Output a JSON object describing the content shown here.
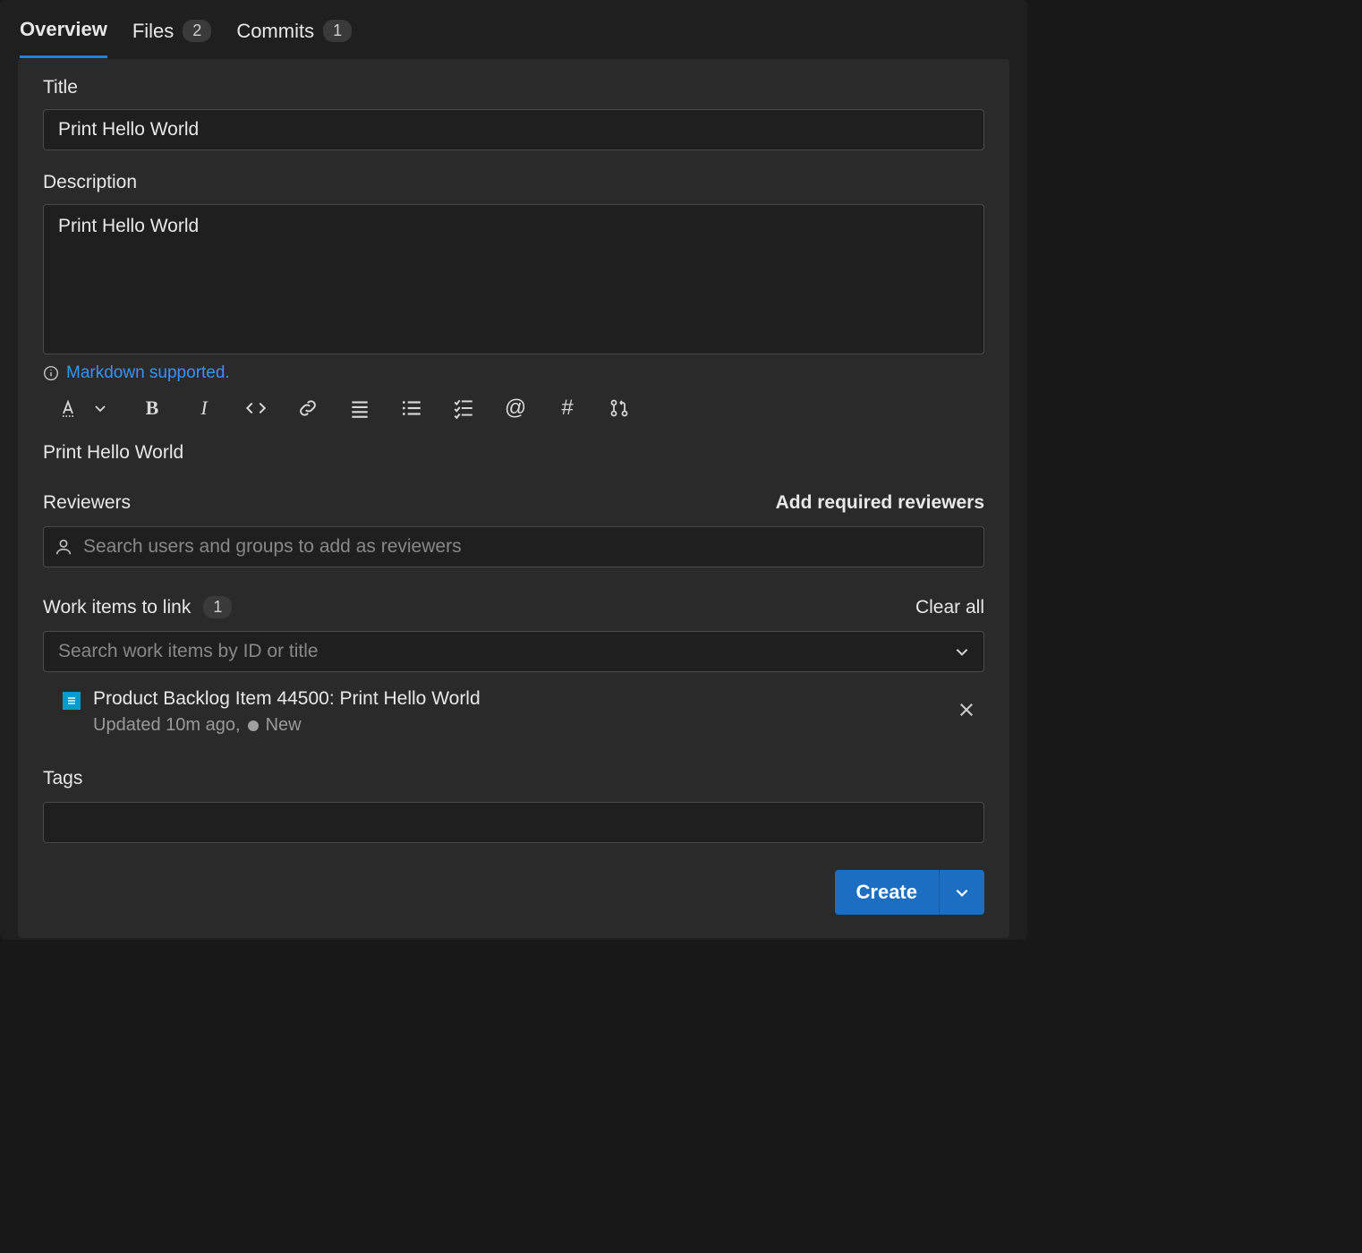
{
  "tabs": {
    "overview": {
      "label": "Overview"
    },
    "files": {
      "label": "Files",
      "count": "2"
    },
    "commits": {
      "label": "Commits",
      "count": "1"
    }
  },
  "title": {
    "label": "Title",
    "value": "Print Hello World"
  },
  "description": {
    "label": "Description",
    "value": "Print Hello World",
    "markdown_hint": "Markdown supported.",
    "preview": "Print Hello World"
  },
  "reviewers": {
    "label": "Reviewers",
    "add_required": "Add required reviewers",
    "placeholder": "Search users and groups to add as reviewers"
  },
  "work_items": {
    "label": "Work items to link",
    "count": "1",
    "clear_all": "Clear all",
    "placeholder": "Search work items by ID or title",
    "items": [
      {
        "title": "Product Backlog Item 44500: Print Hello World",
        "updated": "Updated 10m ago,",
        "state": "New"
      }
    ]
  },
  "tags": {
    "label": "Tags",
    "value": ""
  },
  "footer": {
    "create": "Create"
  },
  "icons": {
    "text_style": "text-style",
    "bold": "B",
    "italic": "I",
    "code": "code",
    "link": "link",
    "ul": "ul",
    "ol": "ol",
    "checklist": "checklist",
    "mention": "@",
    "hash": "#",
    "pr": "pr"
  }
}
